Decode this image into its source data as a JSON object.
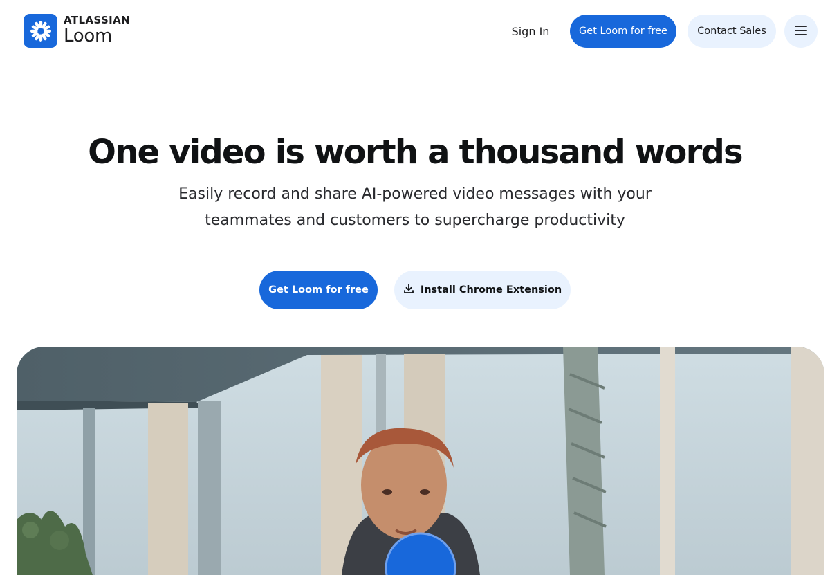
{
  "brand": {
    "company": "ATLASSIAN",
    "product": "Loom",
    "color": "#1868db",
    "logo_icon": "loom-starburst-icon"
  },
  "nav": {
    "sign_in": "Sign In",
    "get_free": "Get Loom for free",
    "contact_sales": "Contact Sales",
    "menu_icon": "hamburger-menu-icon"
  },
  "hero": {
    "title": "One video is worth a thousand words",
    "subtitle_line1": "Easily record and share AI-powered video messages with your",
    "subtitle_line2": "teammates and customers to supercharge productivity",
    "primary_cta": "Get Loom for free",
    "secondary_cta": "Install Chrome Extension",
    "secondary_icon": "download-icon"
  },
  "video": {
    "content": "office-scene-with-man-speaking",
    "play_icon": "play-button-icon"
  },
  "colors": {
    "primary": "#1868db",
    "secondary_bg": "#e9f2fe",
    "heading": "#101214",
    "body_text": "#292a2e"
  }
}
